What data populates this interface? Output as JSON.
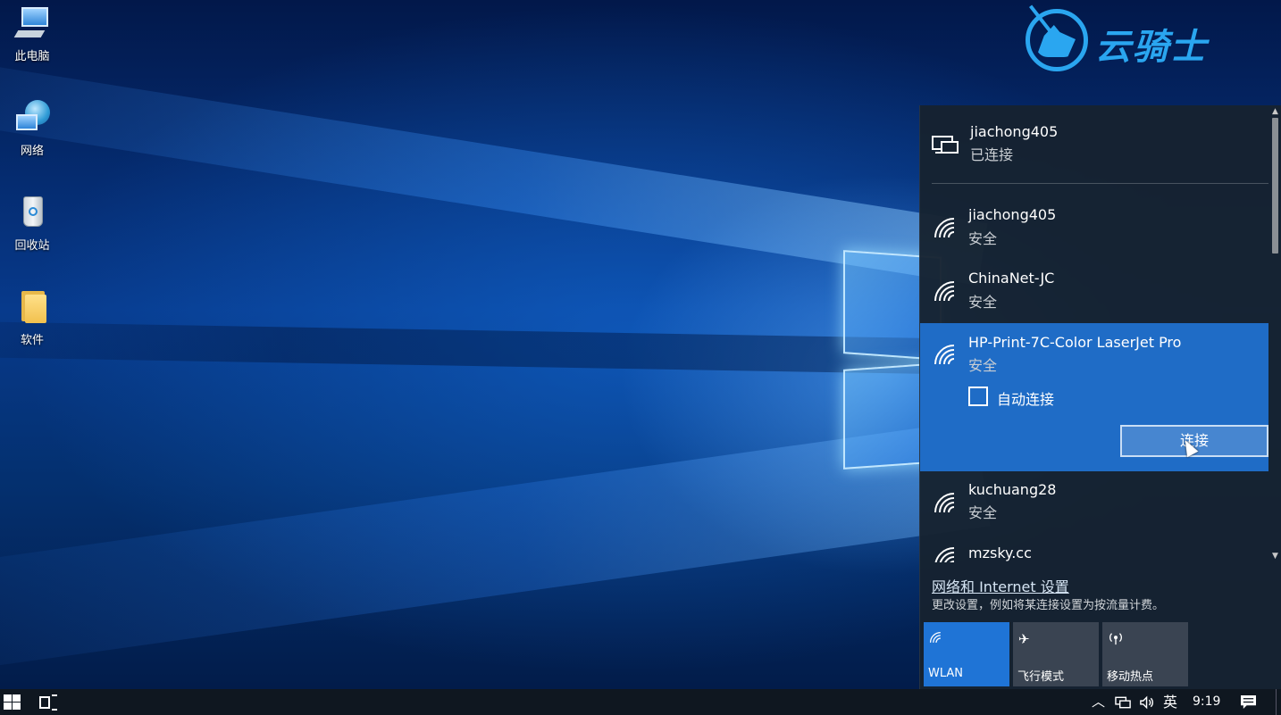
{
  "desktop": {
    "icons": [
      {
        "label": "此电脑",
        "icon": "computer-icon"
      },
      {
        "label": "网络",
        "icon": "network-icon"
      },
      {
        "label": "回收站",
        "icon": "recycle-bin-icon"
      },
      {
        "label": "软件",
        "icon": "folder-icon"
      }
    ]
  },
  "watermark": {
    "text": "云骑士",
    "color": "#2aa6f0"
  },
  "flyout": {
    "wired": {
      "name": "jiachong405",
      "status": "已连接",
      "icon": "ethernet-icon"
    },
    "networks": [
      {
        "name": "jiachong405",
        "status": "安全",
        "icon": "wifi-icon"
      },
      {
        "name": "ChinaNet-JC",
        "status": "安全",
        "icon": "wifi-icon"
      },
      {
        "name": "HP-Print-7C-Color LaserJet Pro",
        "status": "安全",
        "icon": "wifi-icon",
        "selected": true,
        "auto_connect_label": "自动连接",
        "auto_connect_checked": false,
        "connect_label": "连接"
      },
      {
        "name": "kuchuang28",
        "status": "安全",
        "icon": "wifi-icon"
      },
      {
        "name": "mzsky.cc",
        "status": "",
        "icon": "wifi-icon"
      }
    ],
    "settings_link": "网络和 Internet 设置",
    "settings_desc": "更改设置，例如将某连接设置为按流量计费。",
    "quick_actions": [
      {
        "label": "WLAN",
        "icon": "wifi-icon",
        "active": true
      },
      {
        "label": "飞行模式",
        "icon": "airplane-icon",
        "active": false
      },
      {
        "label": "移动热点",
        "icon": "hotspot-icon",
        "active": false
      }
    ],
    "colors": {
      "selected": "#1f6cc6",
      "active_tile": "#1f74d6",
      "panel": "#162230"
    }
  },
  "taskbar": {
    "ime": "英",
    "clock": "9:19",
    "tray_icons": [
      "chevron-up-icon",
      "network-icon",
      "volume-icon",
      "notification-icon"
    ]
  }
}
